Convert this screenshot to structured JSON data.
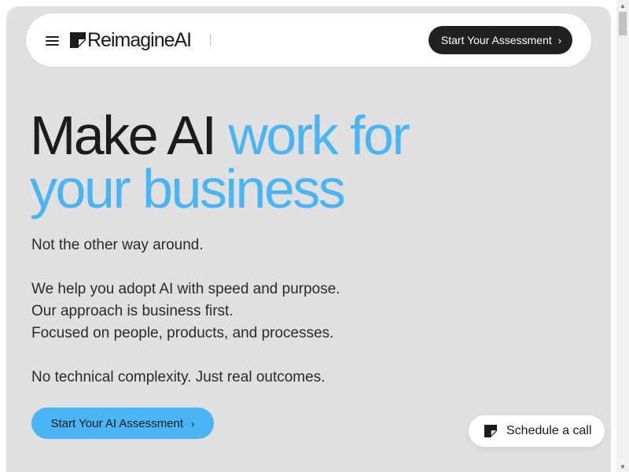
{
  "brand": {
    "name": "ReimagineAI",
    "accent_color": "#49b5f4",
    "dark_color": "#202020"
  },
  "navbar": {
    "menu_icon": "hamburger-icon",
    "cta_label": "Start Your Assessment",
    "cta_icon": "chevron-right-icon"
  },
  "hero": {
    "title_part1": "Make AI ",
    "title_part2": "work for your business",
    "tagline": "Not the other way around.",
    "line1": "We help you adopt AI with speed and purpose.",
    "line2": "Our approach is business first.",
    "line3": "Focused on people, products, and processes.",
    "line4": "No technical complexity. Just real outcomes.",
    "cta_label": "Start Your AI Assessment",
    "cta_icon": "chevron-right-icon"
  },
  "floating": {
    "schedule_label": "Schedule a call",
    "schedule_icon": "brand-mark-icon"
  },
  "scrollbar": {
    "up_icon": "triangle-up-icon",
    "down_icon": "triangle-down-icon"
  }
}
